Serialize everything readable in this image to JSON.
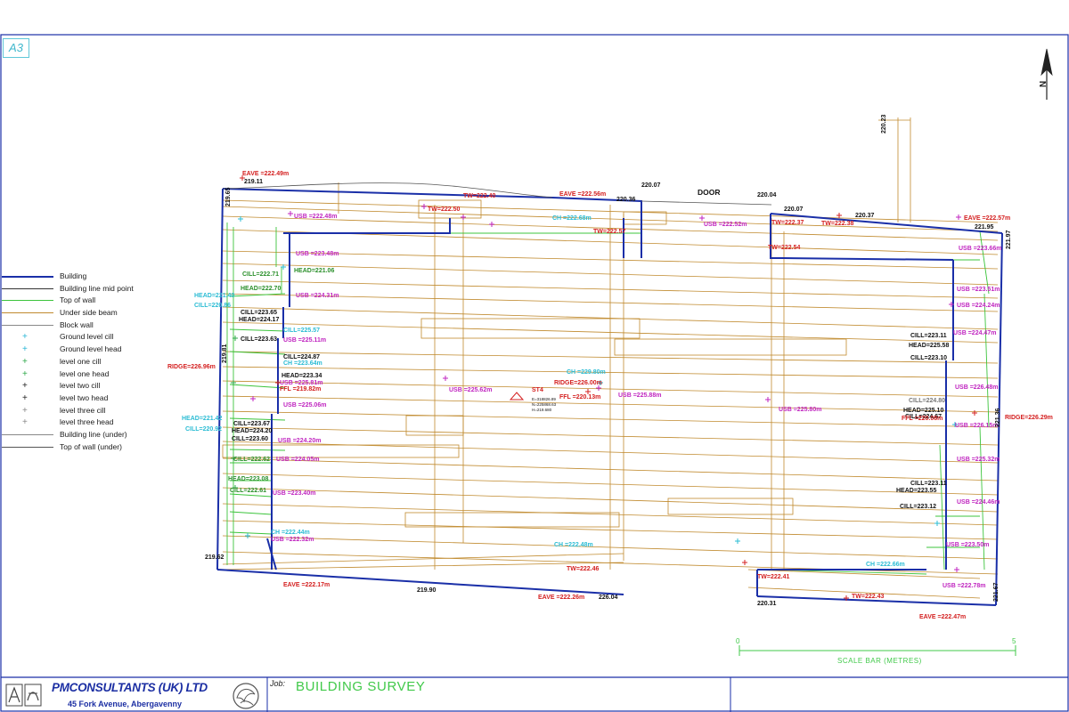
{
  "sheet": {
    "size": "A3"
  },
  "north": {
    "label": "N"
  },
  "legend": [
    {
      "label": "Building",
      "style": "line",
      "color": "#1a2fa8",
      "width": 2
    },
    {
      "label": "Building line mid point",
      "style": "line",
      "color": "#333333",
      "width": 1
    },
    {
      "label": "Top of wall",
      "style": "line",
      "color": "#3cc43c",
      "width": 1
    },
    {
      "label": "Under side beam",
      "style": "line",
      "color": "#c08a2e",
      "width": 1
    },
    {
      "label": "Block wall",
      "style": "line",
      "color": "#888888",
      "width": 1
    },
    {
      "label": "Ground level cill",
      "style": "mark",
      "color": "#29b6d6",
      "mark": "+"
    },
    {
      "label": "Ground level head",
      "style": "mark",
      "color": "#29b6d6",
      "mark": "+"
    },
    {
      "label": "level one cill",
      "style": "mark",
      "color": "#2fa84a",
      "mark": "+"
    },
    {
      "label": "level one head",
      "style": "mark",
      "color": "#2fa84a",
      "mark": "+"
    },
    {
      "label": "level two cill",
      "style": "mark",
      "color": "#222222",
      "mark": "+"
    },
    {
      "label": "level two head",
      "style": "mark",
      "color": "#222222",
      "mark": "+"
    },
    {
      "label": "level three cill",
      "style": "mark",
      "color": "#888888",
      "mark": "+"
    },
    {
      "label": "level three head",
      "style": "mark",
      "color": "#888888",
      "mark": "+"
    },
    {
      "label": "Building line (under)",
      "style": "line",
      "color": "#888888",
      "width": 1
    },
    {
      "label": "Top of wall (under)",
      "style": "line",
      "color": "#555555",
      "width": 1
    }
  ],
  "colors": {
    "building": "#1a2fa8",
    "beam": "#c08a2e",
    "wall": "#3cc43c",
    "red": "#d42020",
    "magenta": "#c026c0",
    "cyan": "#2bbcd4",
    "black": "#111111"
  },
  "plan_labels": [
    {
      "id": "door",
      "text": "DOOR",
      "kind": "black"
    },
    {
      "id": "eave-tl",
      "text": "EAVE =222.49m",
      "kind": "red"
    },
    {
      "id": "lvl-21911",
      "text": "219.11",
      "kind": "black"
    },
    {
      "id": "eave-top",
      "text": "EAVE =222.56m",
      "kind": "red"
    },
    {
      "id": "tw-22240",
      "text": "TW=222.40",
      "kind": "red"
    },
    {
      "id": "tw-22250",
      "text": "TW=222.50",
      "kind": "red"
    },
    {
      "id": "lvl-22007a",
      "text": "220.07",
      "kind": "black"
    },
    {
      "id": "lvl-22004",
      "text": "220.04",
      "kind": "black"
    },
    {
      "id": "lvl-22036",
      "text": "220.36",
      "kind": "black"
    },
    {
      "id": "lvl-22007b",
      "text": "220.07",
      "kind": "black"
    },
    {
      "id": "lvl-22037",
      "text": "220.37",
      "kind": "black"
    },
    {
      "id": "eave-tr",
      "text": "EAVE =222.57m",
      "kind": "red"
    },
    {
      "id": "lvl-22195",
      "text": "221.95",
      "kind": "black"
    },
    {
      "id": "usb-22248",
      "text": "USB =222.48m",
      "kind": "magenta"
    },
    {
      "id": "ch-22268",
      "text": "CH =222.68m",
      "kind": "cyan"
    },
    {
      "id": "usb-22252",
      "text": "USB =222.52m",
      "kind": "magenta"
    },
    {
      "id": "tw-22237",
      "text": "TW=222.37",
      "kind": "red"
    },
    {
      "id": "tw-22238",
      "text": "TW=222.38",
      "kind": "red"
    },
    {
      "id": "tw-22257",
      "text": "TW=222.57",
      "kind": "red"
    },
    {
      "id": "tw-22254",
      "text": "TW=222.54",
      "kind": "red"
    },
    {
      "id": "usb-22348",
      "text": "USB =223.48m",
      "kind": "magenta"
    },
    {
      "id": "head-22106",
      "text": "HEAD=221.06",
      "kind": "green"
    },
    {
      "id": "cill-22271",
      "text": "CILL=222.71",
      "kind": "green"
    },
    {
      "id": "head-22270",
      "text": "HEAD=222.70",
      "kind": "green"
    },
    {
      "id": "usb-22431",
      "text": "USB =224.31m",
      "kind": "magenta"
    },
    {
      "id": "head-22140",
      "text": "HEAD=221.40",
      "kind": "cyan"
    },
    {
      "id": "cill-22086",
      "text": "CILL=220.86",
      "kind": "cyan"
    },
    {
      "id": "cill-22365",
      "text": "CILL=223.65",
      "kind": "black"
    },
    {
      "id": "head-22417",
      "text": "HEAD=224.17",
      "kind": "black"
    },
    {
      "id": "cill-22557",
      "text": "CILL=225.57",
      "kind": "cyan"
    },
    {
      "id": "usb-22511",
      "text": "USB =225.11m",
      "kind": "magenta"
    },
    {
      "id": "cill-22363",
      "text": "CILL=223.63",
      "kind": "black"
    },
    {
      "id": "cill-22487",
      "text": "CILL=224.87",
      "kind": "black"
    },
    {
      "id": "ch-22364",
      "text": "CH =223.64m",
      "kind": "cyan"
    },
    {
      "id": "ridge-22696",
      "text": "RIDGE=226.96m",
      "kind": "red"
    },
    {
      "id": "head-22334",
      "text": "HEAD=223.34",
      "kind": "black"
    },
    {
      "id": "usb-22581",
      "text": "USB =225.81m",
      "kind": "magenta"
    },
    {
      "id": "ffl-21982",
      "text": "FFL =219.82m",
      "kind": "red"
    },
    {
      "id": "usb-22506",
      "text": "USB =225.06m",
      "kind": "magenta"
    },
    {
      "id": "usb-22562",
      "text": "USB =225.62m",
      "kind": "magenta"
    },
    {
      "id": "ch-22980",
      "text": "CH =229.80m",
      "kind": "cyan"
    },
    {
      "id": "ridge-22600",
      "text": "RIDGE=226.00m",
      "kind": "red"
    },
    {
      "id": "ffl-22013",
      "text": "FFL =220.13m",
      "kind": "red"
    },
    {
      "id": "usb-22588",
      "text": "USB =225.88m",
      "kind": "magenta"
    },
    {
      "id": "usb-22580",
      "text": "USB =225.80m",
      "kind": "magenta"
    },
    {
      "id": "head-22142",
      "text": "HEAD=221.42",
      "kind": "cyan"
    },
    {
      "id": "cill-22092",
      "text": "CILL=220.92",
      "kind": "cyan"
    },
    {
      "id": "cill-22367",
      "text": "CILL=223.67",
      "kind": "black"
    },
    {
      "id": "head-22420",
      "text": "HEAD=224.20",
      "kind": "black"
    },
    {
      "id": "cill-22360",
      "text": "CILL=223.60",
      "kind": "black"
    },
    {
      "id": "usb-22420",
      "text": "USB =224.20m",
      "kind": "magenta"
    },
    {
      "id": "cill-22362",
      "text": "CILL=222.62",
      "kind": "green"
    },
    {
      "id": "usb-22405",
      "text": "USB =224.05m",
      "kind": "magenta"
    },
    {
      "id": "head-22308",
      "text": "HEAD=223.08",
      "kind": "green"
    },
    {
      "id": "cill-22261",
      "text": "CILL=222.61",
      "kind": "green"
    },
    {
      "id": "usb-22340",
      "text": "USB =223.40m",
      "kind": "magenta"
    },
    {
      "id": "ch-22244",
      "text": "CH =222.44m",
      "kind": "cyan"
    },
    {
      "id": "usb-22232",
      "text": "USB =222.32m",
      "kind": "magenta"
    },
    {
      "id": "ch-22248",
      "text": "CH =222.48m",
      "kind": "cyan"
    },
    {
      "id": "tw-22246",
      "text": "TW=222.46",
      "kind": "red"
    },
    {
      "id": "lvl-21962",
      "text": "219.62",
      "kind": "black"
    },
    {
      "id": "eave-22217",
      "text": "EAVE =222.17m",
      "kind": "red"
    },
    {
      "id": "lvl-21990",
      "text": "219.90",
      "kind": "black"
    },
    {
      "id": "eave-22226",
      "text": "EAVE =222.26m",
      "kind": "red"
    },
    {
      "id": "lvl-22604",
      "text": "226.04",
      "kind": "black"
    },
    {
      "id": "usb-22366",
      "text": "USB =223.66m",
      "kind": "magenta"
    },
    {
      "id": "usb-22351",
      "text": "USB =223.51m",
      "kind": "magenta"
    },
    {
      "id": "usb-22424",
      "text": "USB =224.24m",
      "kind": "magenta"
    },
    {
      "id": "usb-22447",
      "text": "USB =224.47m",
      "kind": "magenta"
    },
    {
      "id": "cill-22311",
      "text": "CILL=223.11",
      "kind": "black"
    },
    {
      "id": "head-22558",
      "text": "HEAD=225.58",
      "kind": "black"
    },
    {
      "id": "cill-22310",
      "text": "CILL=223.10",
      "kind": "black"
    },
    {
      "id": "usb-22648",
      "text": "USB =226.48m",
      "kind": "magenta"
    },
    {
      "id": "cill-22480",
      "text": "CILL=224.80",
      "kind": "grey"
    },
    {
      "id": "head-22510",
      "text": "HEAD=225.10",
      "kind": "black"
    },
    {
      "id": "cill-22467",
      "text": "CILL=224.67",
      "kind": "black"
    },
    {
      "id": "ffl-22008",
      "text": "FFL =220.08m",
      "kind": "red"
    },
    {
      "id": "ridge-22629",
      "text": "RIDGE=226.29m",
      "kind": "red"
    },
    {
      "id": "usb-22615",
      "text": "USB =226.15m",
      "kind": "magenta"
    },
    {
      "id": "usb-22532",
      "text": "USB =225.32m",
      "kind": "magenta"
    },
    {
      "id": "cill-22311b",
      "text": "CILL=223.11",
      "kind": "black"
    },
    {
      "id": "head-22355",
      "text": "HEAD=223.55",
      "kind": "black"
    },
    {
      "id": "cill-22312",
      "text": "CILL=223.12",
      "kind": "black"
    },
    {
      "id": "usb-22446",
      "text": "USB =224.46m",
      "kind": "magenta"
    },
    {
      "id": "usb-22350",
      "text": "USB =223.50m",
      "kind": "magenta"
    },
    {
      "id": "ch-22266",
      "text": "CH =222.66m",
      "kind": "cyan"
    },
    {
      "id": "usb-22278",
      "text": "USB =222.78m",
      "kind": "magenta"
    },
    {
      "id": "tw-22241",
      "text": "TW=222.41",
      "kind": "red"
    },
    {
      "id": "tw-22243",
      "text": "TW=222.43",
      "kind": "red"
    },
    {
      "id": "lvl-22031",
      "text": "220.31",
      "kind": "black"
    },
    {
      "id": "eave-22247",
      "text": "EAVE =222.47m",
      "kind": "red"
    },
    {
      "id": "lvl-22167",
      "text": "221.67",
      "kind": "black"
    },
    {
      "id": "lvl-22136",
      "text": "221.36",
      "kind": "black"
    },
    {
      "id": "lvl-21965",
      "text": "219.65",
      "kind": "black"
    },
    {
      "id": "lvl-21981",
      "text": "219.81",
      "kind": "black"
    },
    {
      "id": "lvl-22197",
      "text": "221.97",
      "kind": "black"
    },
    {
      "id": "lvl-22023",
      "text": "220.23",
      "kind": "black"
    },
    {
      "id": "station",
      "text": "ST4",
      "kind": "red"
    },
    {
      "id": "station-e",
      "text": "E=318826.89",
      "kind": "black"
    },
    {
      "id": "station-n",
      "text": "N=225868.63",
      "kind": "black"
    },
    {
      "id": "station-z",
      "text": "H=219.680",
      "kind": "black"
    }
  ],
  "scale_bar": {
    "start": "0",
    "end": "5",
    "label": "SCALE BAR (METRES)"
  },
  "title_block": {
    "company": "PMCONSULTANTS (UK) LTD",
    "address": "45 Fork Avenue, Abergavenny",
    "job_label": "Job:",
    "job_title": "BUILDING SURVEY"
  }
}
